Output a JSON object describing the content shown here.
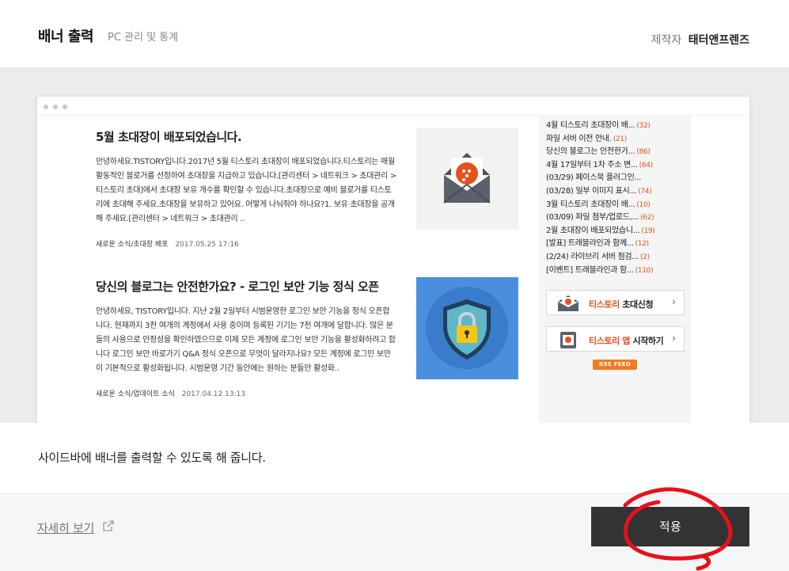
{
  "header": {
    "title": "배너 출력",
    "subtitle": "PC 관리 및 통계",
    "maker_label": "제작자",
    "maker_name": "태터앤프렌즈"
  },
  "posts": [
    {
      "title": "5월 초대장이 배포되었습니다.",
      "excerpt": "안녕하세요.TISTORY입니다.2017년 5월 티스토리 초대장이 배포되었습니다.티스토리는 매월 활동적인 블로거를 선정하여 초대장을 지급하고 있습니다.[관리센터 > 네트워크 > 초대관리 > 티스토리 초대]에서 초대장 보유 개수를 확인할 수 있습니다.초대장으로 예비 블로거를 티스토리에 초대해 주세요.초대장을 보유하고 있어요. 어떻게 나눠줘야 하나요?1. 보유 초대장을 공개해 주세요.[관리센터 > 네트워크 > 초대관리 ..",
      "category": "새로운 소식/초대장 배포",
      "date": "2017.05.25 17:16"
    },
    {
      "title": "당신의 블로그는 안전한가요? - 로그인 보안 기능 정식 오픈",
      "excerpt": "안녕하세요, TISTORY입니다. 지난 2월 2일부터 시범운영한 로그인 보안 기능을 정식 오픈합니다. 현재까지 3천 여개의 계정에서 사용 중이며 등록된 기기는 7천 여개에 달합니다. 많은 분들의 사용으로 안정성을 확인하였으므로 이제 모든 계정에 로그인 보안 기능을 활성화하려고 합니다 로그인 보안 바로가기 Q&A 정식 오픈으로 무엇이 달라지나요? 모든 계정에 로그인 보안이 기본적으로 활성화됩니다. 시범운영 기간 동안에는 원하는 분들만 활성화..",
      "category": "새로운 소식/업데이트 소식",
      "date": "2017.04.12 13:13"
    }
  ],
  "sidebar": {
    "recent": [
      {
        "title": "4월 티스토리 초대장이 배...",
        "count": "(32)"
      },
      {
        "title": "파일 서버 이전 안내.",
        "count": "(21)"
      },
      {
        "title": "당신의 블로그는 안전한가...",
        "count": "(86)"
      },
      {
        "title": "4월 17일부터 1차 주소 변...",
        "count": "(64)"
      },
      {
        "title": "(03/29) 페이스북 플러그인...",
        "count": ""
      },
      {
        "title": "(03/28) 일부 이미지 표시...",
        "count": "(74)"
      },
      {
        "title": "3월 티스토리 초대장이 배...",
        "count": "(10)"
      },
      {
        "title": "(03/09) 파일 첨부/업로드,...",
        "count": "(62)"
      },
      {
        "title": "2월 초대장이 배포되었습니...",
        "count": "(19)"
      },
      {
        "title": "[발표] 트래블라인과 함께...",
        "count": "(12)"
      },
      {
        "title": "(2/24) 라이브리 서버 점검...",
        "count": "(2)"
      },
      {
        "title": "[이벤트] 트래블라인과 함...",
        "count": "(110)"
      }
    ],
    "invite_banner": {
      "brand": "티스토리",
      "label": "초대신청"
    },
    "app_banner": {
      "brand": "티스토리 앱",
      "label": "시작하기"
    },
    "rss_label": "RSS FEED"
  },
  "description": "사이드바에 배너를 출력할 수 있도록 해 줍니다.",
  "footer": {
    "detail_link": "자세히 보기",
    "apply_button": "적용"
  },
  "colors": {
    "brand_orange": "#e8511a",
    "apply_button_bg": "#333333",
    "annotation_red": "#e8101a"
  }
}
